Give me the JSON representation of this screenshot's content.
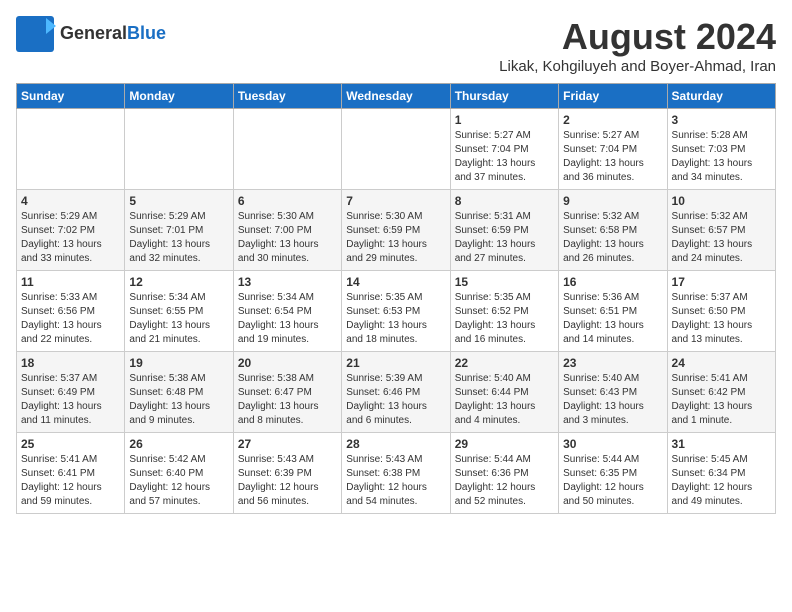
{
  "header": {
    "logo_general": "General",
    "logo_blue": "Blue",
    "month_year": "August 2024",
    "location": "Likak, Kohgiluyeh and Boyer-Ahmad, Iran"
  },
  "weekdays": [
    "Sunday",
    "Monday",
    "Tuesday",
    "Wednesday",
    "Thursday",
    "Friday",
    "Saturday"
  ],
  "weeks": [
    [
      {
        "day": "",
        "info": ""
      },
      {
        "day": "",
        "info": ""
      },
      {
        "day": "",
        "info": ""
      },
      {
        "day": "",
        "info": ""
      },
      {
        "day": "1",
        "info": "Sunrise: 5:27 AM\nSunset: 7:04 PM\nDaylight: 13 hours\nand 37 minutes."
      },
      {
        "day": "2",
        "info": "Sunrise: 5:27 AM\nSunset: 7:04 PM\nDaylight: 13 hours\nand 36 minutes."
      },
      {
        "day": "3",
        "info": "Sunrise: 5:28 AM\nSunset: 7:03 PM\nDaylight: 13 hours\nand 34 minutes."
      }
    ],
    [
      {
        "day": "4",
        "info": "Sunrise: 5:29 AM\nSunset: 7:02 PM\nDaylight: 13 hours\nand 33 minutes."
      },
      {
        "day": "5",
        "info": "Sunrise: 5:29 AM\nSunset: 7:01 PM\nDaylight: 13 hours\nand 32 minutes."
      },
      {
        "day": "6",
        "info": "Sunrise: 5:30 AM\nSunset: 7:00 PM\nDaylight: 13 hours\nand 30 minutes."
      },
      {
        "day": "7",
        "info": "Sunrise: 5:30 AM\nSunset: 6:59 PM\nDaylight: 13 hours\nand 29 minutes."
      },
      {
        "day": "8",
        "info": "Sunrise: 5:31 AM\nSunset: 6:59 PM\nDaylight: 13 hours\nand 27 minutes."
      },
      {
        "day": "9",
        "info": "Sunrise: 5:32 AM\nSunset: 6:58 PM\nDaylight: 13 hours\nand 26 minutes."
      },
      {
        "day": "10",
        "info": "Sunrise: 5:32 AM\nSunset: 6:57 PM\nDaylight: 13 hours\nand 24 minutes."
      }
    ],
    [
      {
        "day": "11",
        "info": "Sunrise: 5:33 AM\nSunset: 6:56 PM\nDaylight: 13 hours\nand 22 minutes."
      },
      {
        "day": "12",
        "info": "Sunrise: 5:34 AM\nSunset: 6:55 PM\nDaylight: 13 hours\nand 21 minutes."
      },
      {
        "day": "13",
        "info": "Sunrise: 5:34 AM\nSunset: 6:54 PM\nDaylight: 13 hours\nand 19 minutes."
      },
      {
        "day": "14",
        "info": "Sunrise: 5:35 AM\nSunset: 6:53 PM\nDaylight: 13 hours\nand 18 minutes."
      },
      {
        "day": "15",
        "info": "Sunrise: 5:35 AM\nSunset: 6:52 PM\nDaylight: 13 hours\nand 16 minutes."
      },
      {
        "day": "16",
        "info": "Sunrise: 5:36 AM\nSunset: 6:51 PM\nDaylight: 13 hours\nand 14 minutes."
      },
      {
        "day": "17",
        "info": "Sunrise: 5:37 AM\nSunset: 6:50 PM\nDaylight: 13 hours\nand 13 minutes."
      }
    ],
    [
      {
        "day": "18",
        "info": "Sunrise: 5:37 AM\nSunset: 6:49 PM\nDaylight: 13 hours\nand 11 minutes."
      },
      {
        "day": "19",
        "info": "Sunrise: 5:38 AM\nSunset: 6:48 PM\nDaylight: 13 hours\nand 9 minutes."
      },
      {
        "day": "20",
        "info": "Sunrise: 5:38 AM\nSunset: 6:47 PM\nDaylight: 13 hours\nand 8 minutes."
      },
      {
        "day": "21",
        "info": "Sunrise: 5:39 AM\nSunset: 6:46 PM\nDaylight: 13 hours\nand 6 minutes."
      },
      {
        "day": "22",
        "info": "Sunrise: 5:40 AM\nSunset: 6:44 PM\nDaylight: 13 hours\nand 4 minutes."
      },
      {
        "day": "23",
        "info": "Sunrise: 5:40 AM\nSunset: 6:43 PM\nDaylight: 13 hours\nand 3 minutes."
      },
      {
        "day": "24",
        "info": "Sunrise: 5:41 AM\nSunset: 6:42 PM\nDaylight: 13 hours\nand 1 minute."
      }
    ],
    [
      {
        "day": "25",
        "info": "Sunrise: 5:41 AM\nSunset: 6:41 PM\nDaylight: 12 hours\nand 59 minutes."
      },
      {
        "day": "26",
        "info": "Sunrise: 5:42 AM\nSunset: 6:40 PM\nDaylight: 12 hours\nand 57 minutes."
      },
      {
        "day": "27",
        "info": "Sunrise: 5:43 AM\nSunset: 6:39 PM\nDaylight: 12 hours\nand 56 minutes."
      },
      {
        "day": "28",
        "info": "Sunrise: 5:43 AM\nSunset: 6:38 PM\nDaylight: 12 hours\nand 54 minutes."
      },
      {
        "day": "29",
        "info": "Sunrise: 5:44 AM\nSunset: 6:36 PM\nDaylight: 12 hours\nand 52 minutes."
      },
      {
        "day": "30",
        "info": "Sunrise: 5:44 AM\nSunset: 6:35 PM\nDaylight: 12 hours\nand 50 minutes."
      },
      {
        "day": "31",
        "info": "Sunrise: 5:45 AM\nSunset: 6:34 PM\nDaylight: 12 hours\nand 49 minutes."
      }
    ]
  ]
}
